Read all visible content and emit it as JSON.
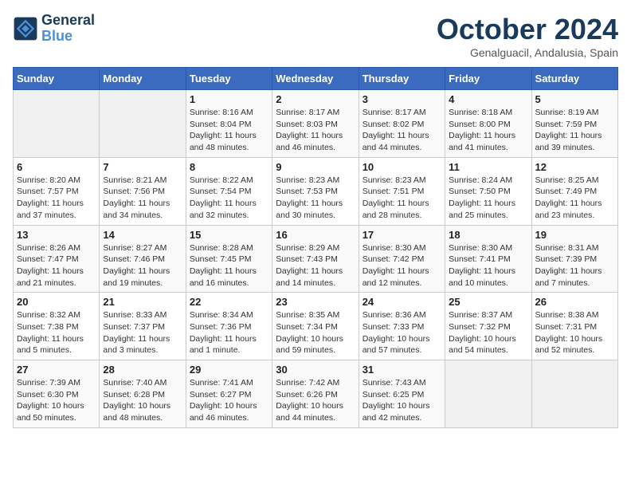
{
  "header": {
    "logo_line1": "General",
    "logo_line2": "Blue",
    "month": "October 2024",
    "location": "Genalguacil, Andalusia, Spain"
  },
  "days_of_week": [
    "Sunday",
    "Monday",
    "Tuesday",
    "Wednesday",
    "Thursday",
    "Friday",
    "Saturday"
  ],
  "weeks": [
    [
      {
        "day": "",
        "info": ""
      },
      {
        "day": "",
        "info": ""
      },
      {
        "day": "1",
        "info": "Sunrise: 8:16 AM\nSunset: 8:04 PM\nDaylight: 11 hours and 48 minutes."
      },
      {
        "day": "2",
        "info": "Sunrise: 8:17 AM\nSunset: 8:03 PM\nDaylight: 11 hours and 46 minutes."
      },
      {
        "day": "3",
        "info": "Sunrise: 8:17 AM\nSunset: 8:02 PM\nDaylight: 11 hours and 44 minutes."
      },
      {
        "day": "4",
        "info": "Sunrise: 8:18 AM\nSunset: 8:00 PM\nDaylight: 11 hours and 41 minutes."
      },
      {
        "day": "5",
        "info": "Sunrise: 8:19 AM\nSunset: 7:59 PM\nDaylight: 11 hours and 39 minutes."
      }
    ],
    [
      {
        "day": "6",
        "info": "Sunrise: 8:20 AM\nSunset: 7:57 PM\nDaylight: 11 hours and 37 minutes."
      },
      {
        "day": "7",
        "info": "Sunrise: 8:21 AM\nSunset: 7:56 PM\nDaylight: 11 hours and 34 minutes."
      },
      {
        "day": "8",
        "info": "Sunrise: 8:22 AM\nSunset: 7:54 PM\nDaylight: 11 hours and 32 minutes."
      },
      {
        "day": "9",
        "info": "Sunrise: 8:23 AM\nSunset: 7:53 PM\nDaylight: 11 hours and 30 minutes."
      },
      {
        "day": "10",
        "info": "Sunrise: 8:23 AM\nSunset: 7:51 PM\nDaylight: 11 hours and 28 minutes."
      },
      {
        "day": "11",
        "info": "Sunrise: 8:24 AM\nSunset: 7:50 PM\nDaylight: 11 hours and 25 minutes."
      },
      {
        "day": "12",
        "info": "Sunrise: 8:25 AM\nSunset: 7:49 PM\nDaylight: 11 hours and 23 minutes."
      }
    ],
    [
      {
        "day": "13",
        "info": "Sunrise: 8:26 AM\nSunset: 7:47 PM\nDaylight: 11 hours and 21 minutes."
      },
      {
        "day": "14",
        "info": "Sunrise: 8:27 AM\nSunset: 7:46 PM\nDaylight: 11 hours and 19 minutes."
      },
      {
        "day": "15",
        "info": "Sunrise: 8:28 AM\nSunset: 7:45 PM\nDaylight: 11 hours and 16 minutes."
      },
      {
        "day": "16",
        "info": "Sunrise: 8:29 AM\nSunset: 7:43 PM\nDaylight: 11 hours and 14 minutes."
      },
      {
        "day": "17",
        "info": "Sunrise: 8:30 AM\nSunset: 7:42 PM\nDaylight: 11 hours and 12 minutes."
      },
      {
        "day": "18",
        "info": "Sunrise: 8:30 AM\nSunset: 7:41 PM\nDaylight: 11 hours and 10 minutes."
      },
      {
        "day": "19",
        "info": "Sunrise: 8:31 AM\nSunset: 7:39 PM\nDaylight: 11 hours and 7 minutes."
      }
    ],
    [
      {
        "day": "20",
        "info": "Sunrise: 8:32 AM\nSunset: 7:38 PM\nDaylight: 11 hours and 5 minutes."
      },
      {
        "day": "21",
        "info": "Sunrise: 8:33 AM\nSunset: 7:37 PM\nDaylight: 11 hours and 3 minutes."
      },
      {
        "day": "22",
        "info": "Sunrise: 8:34 AM\nSunset: 7:36 PM\nDaylight: 11 hours and 1 minute."
      },
      {
        "day": "23",
        "info": "Sunrise: 8:35 AM\nSunset: 7:34 PM\nDaylight: 10 hours and 59 minutes."
      },
      {
        "day": "24",
        "info": "Sunrise: 8:36 AM\nSunset: 7:33 PM\nDaylight: 10 hours and 57 minutes."
      },
      {
        "day": "25",
        "info": "Sunrise: 8:37 AM\nSunset: 7:32 PM\nDaylight: 10 hours and 54 minutes."
      },
      {
        "day": "26",
        "info": "Sunrise: 8:38 AM\nSunset: 7:31 PM\nDaylight: 10 hours and 52 minutes."
      }
    ],
    [
      {
        "day": "27",
        "info": "Sunrise: 7:39 AM\nSunset: 6:30 PM\nDaylight: 10 hours and 50 minutes."
      },
      {
        "day": "28",
        "info": "Sunrise: 7:40 AM\nSunset: 6:28 PM\nDaylight: 10 hours and 48 minutes."
      },
      {
        "day": "29",
        "info": "Sunrise: 7:41 AM\nSunset: 6:27 PM\nDaylight: 10 hours and 46 minutes."
      },
      {
        "day": "30",
        "info": "Sunrise: 7:42 AM\nSunset: 6:26 PM\nDaylight: 10 hours and 44 minutes."
      },
      {
        "day": "31",
        "info": "Sunrise: 7:43 AM\nSunset: 6:25 PM\nDaylight: 10 hours and 42 minutes."
      },
      {
        "day": "",
        "info": ""
      },
      {
        "day": "",
        "info": ""
      }
    ]
  ]
}
